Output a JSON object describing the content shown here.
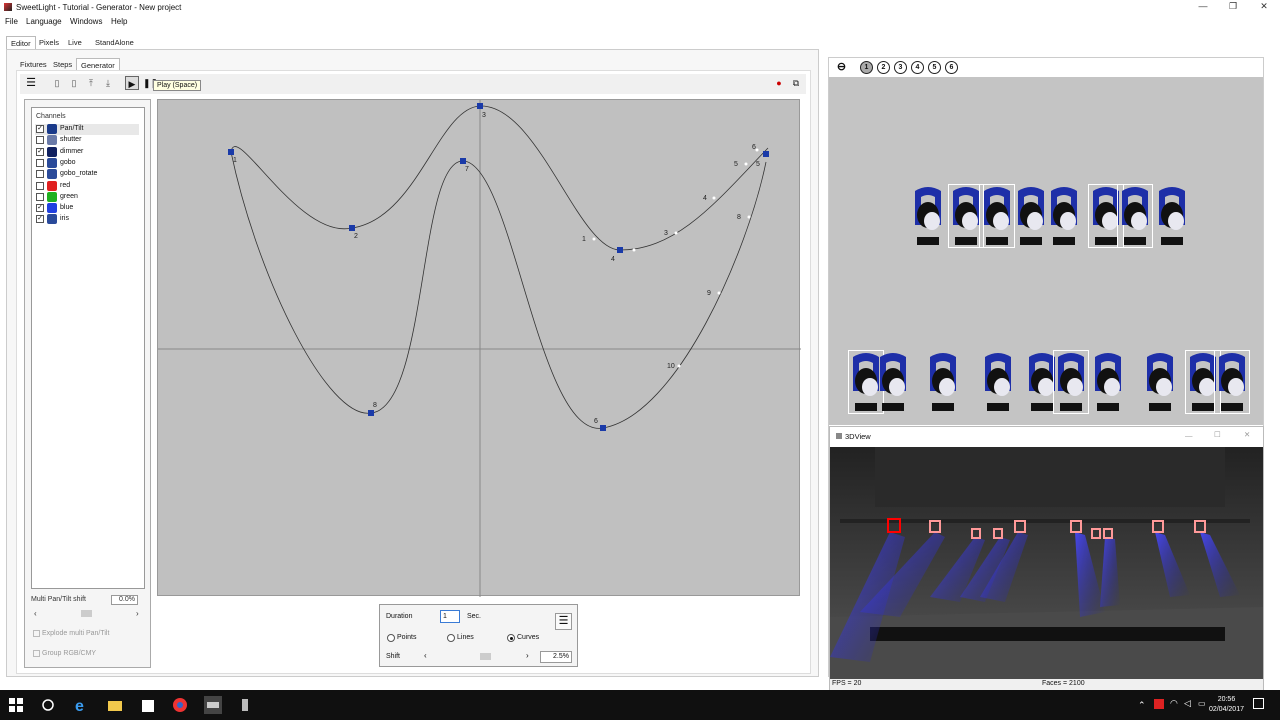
{
  "window": {
    "title": "SweetLight - Tutorial - Generator - New project",
    "minimize": "—",
    "maximize": "❐",
    "close": "✕"
  },
  "menu": [
    "File",
    "Language",
    "Windows",
    "Help"
  ],
  "main_tabs": [
    {
      "label": "Editor",
      "active": true
    },
    {
      "label": "Pixels",
      "active": false
    },
    {
      "label": "Live",
      "active": false
    },
    {
      "label": "StandAlone",
      "active": false
    }
  ],
  "sub_tabs": [
    {
      "label": "Fixtures",
      "active": false
    },
    {
      "label": "Steps",
      "active": false
    },
    {
      "label": "Generator",
      "active": true
    }
  ],
  "tooltip": "Play (Space)",
  "channels": {
    "header": "Channels",
    "items": [
      {
        "label": "Pan/Tilt",
        "checked": true,
        "icon": "pan-tilt-icon",
        "color": "#1a3a8a"
      },
      {
        "label": "shutter",
        "checked": false,
        "icon": "shutter-icon",
        "color": "#6a7aa8"
      },
      {
        "label": "dimmer",
        "checked": true,
        "icon": "dimmer-icon",
        "color": "#102060"
      },
      {
        "label": "gobo",
        "checked": false,
        "icon": "gobo-icon",
        "color": "#2a4a9a"
      },
      {
        "label": "gobo_rotate",
        "checked": false,
        "icon": "gobo-rotate-icon",
        "color": "#2a4a9a"
      },
      {
        "label": "red",
        "checked": false,
        "icon": "red-icon",
        "color": "#e02020"
      },
      {
        "label": "green",
        "checked": false,
        "icon": "green-icon",
        "color": "#20b020"
      },
      {
        "label": "blue",
        "checked": true,
        "icon": "blue-icon",
        "color": "#2040e0"
      },
      {
        "label": "iris",
        "checked": true,
        "icon": "iris-icon",
        "color": "#2a4a9a"
      }
    ]
  },
  "shift_controls": {
    "label": "Multi Pan/Tilt shift",
    "value": "0.0%",
    "explode_label": "Explode multi Pan/Tilt",
    "group_label": "Group RGB/CMY"
  },
  "bottom_box": {
    "duration_label": "Duration",
    "duration_value": "1",
    "sec_label": "Sec.",
    "points_label": "Points",
    "lines_label": "Lines",
    "curves_label": "Curves",
    "selected_mode": "Curves",
    "shift_label": "Shift",
    "shift_value": "2.5%"
  },
  "curve_points": {
    "upper": [
      "1",
      "2",
      "3",
      "4",
      "5"
    ],
    "lower": [
      "6",
      "7",
      "8"
    ],
    "small_labels": [
      "1",
      "2",
      "3",
      "4",
      "5",
      "6",
      "7",
      "8",
      "9",
      "10"
    ]
  },
  "right_toolbar": [
    "⊖",
    "1",
    "2",
    "3",
    "4",
    "5",
    "6"
  ],
  "view3d": {
    "title": "3DView",
    "fps": "FPS = 20",
    "faces": "Faces = 2100"
  },
  "taskbar": {
    "time": "20:56",
    "date": "02/04/2017"
  }
}
